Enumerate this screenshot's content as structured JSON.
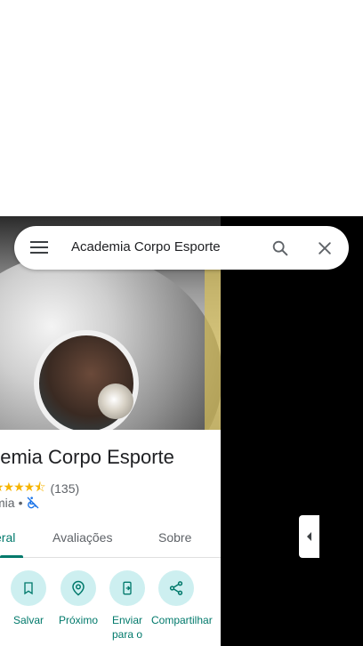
{
  "search": {
    "query": "Academia Corpo Esporte"
  },
  "place": {
    "title": "Academia Corpo Esporte",
    "title_visible": "demia Corpo Esporte",
    "rating": "4.4",
    "stars": "★★★★⯪",
    "reviews_count": "(135)",
    "category_visible": "mia",
    "category_separator": "•"
  },
  "tabs": [
    {
      "label": "eral"
    },
    {
      "label": "Avaliações"
    },
    {
      "label": "Sobre"
    }
  ],
  "actions": [
    {
      "label": "Salvar",
      "icon": "bookmark-icon"
    },
    {
      "label": "Próximo",
      "icon": "nearby-icon"
    },
    {
      "label": "Enviar para o",
      "icon": "send-to-phone-icon"
    },
    {
      "label": "Compartilhar",
      "icon": "share-icon"
    }
  ],
  "colors": {
    "accent": "#00796b",
    "action_bg": "#cdeff0",
    "star": "#f6b400"
  }
}
